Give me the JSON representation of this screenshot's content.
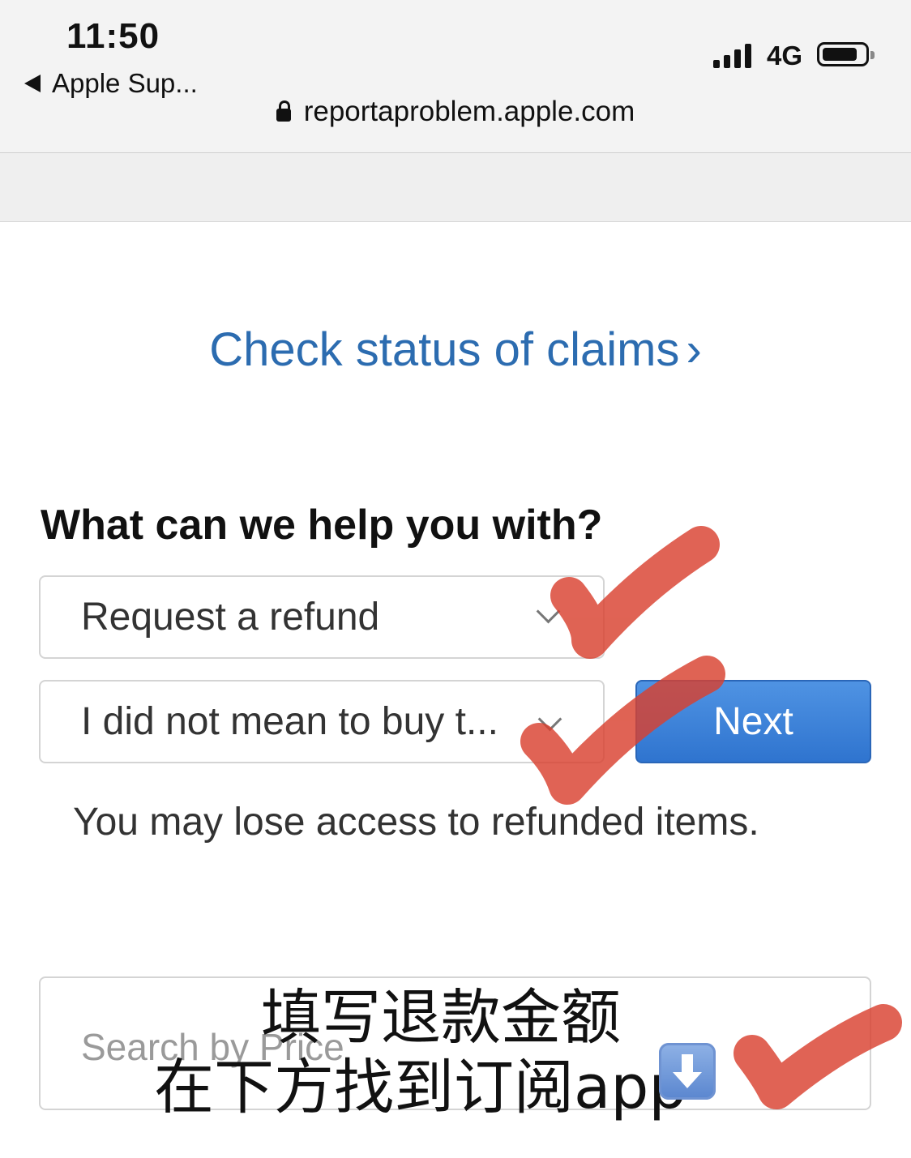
{
  "status_bar": {
    "time": "11:50",
    "back_label": "Apple Sup...",
    "network": "4G"
  },
  "address_bar": {
    "url": "reportaproblem.apple.com"
  },
  "main": {
    "claims_link": "Check status of claims",
    "claims_chevron": "›",
    "heading": "What can we help you with?",
    "request_select": "Request a refund",
    "reason_select": "I did not mean to buy t...",
    "next_button": "Next",
    "note": "You may lose access to refunded items.",
    "search_placeholder": "Search by Price"
  },
  "annotation": {
    "line1": "填写退款金额",
    "line2": "在下方找到订阅app",
    "checkmark_color": "#d9412f"
  },
  "colors": {
    "link": "#2c6cb0",
    "button": "#3a7fd6"
  }
}
